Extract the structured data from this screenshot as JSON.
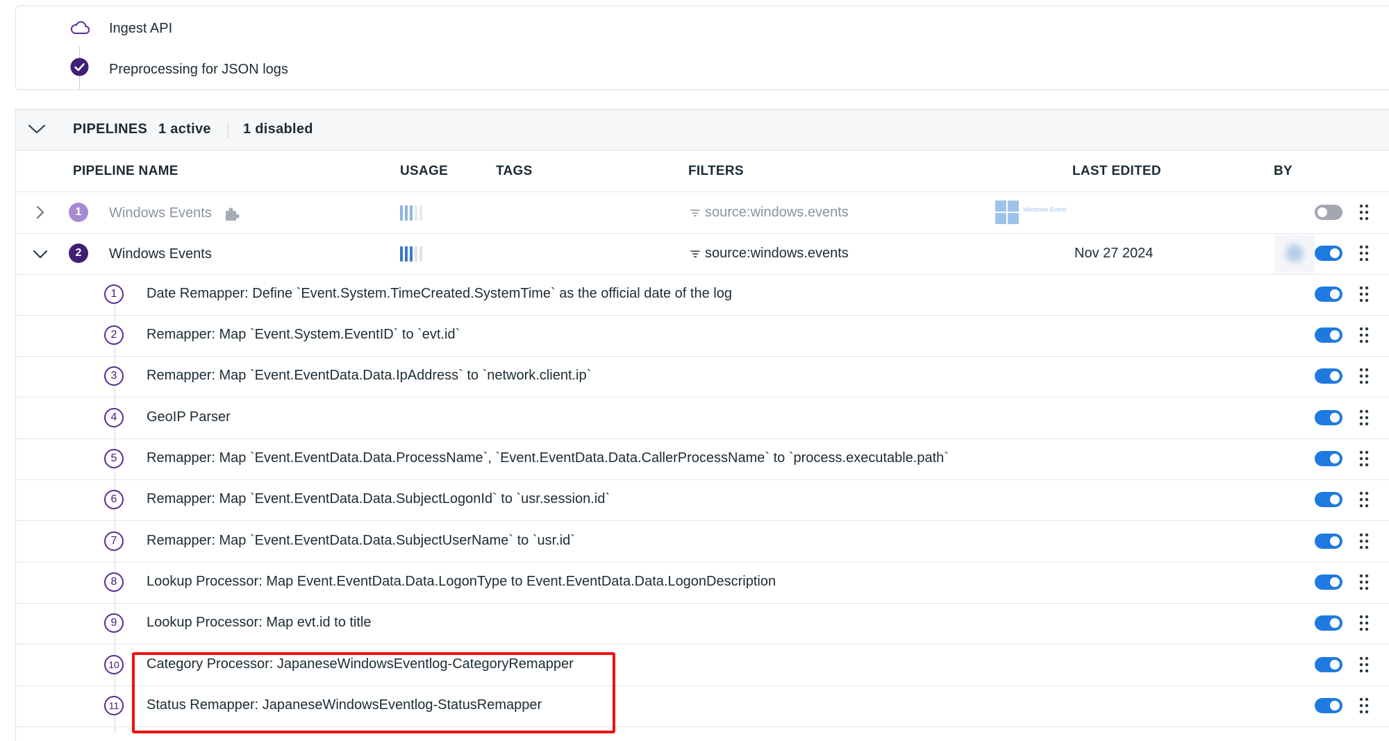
{
  "preprocessing": {
    "items": [
      {
        "label": "Ingest API",
        "icon": "cloud-icon"
      },
      {
        "label": "Preprocessing for JSON logs",
        "icon": "check-circle-icon"
      }
    ]
  },
  "pipelines_header": {
    "title": "PIPELINES",
    "active": "1 active",
    "disabled": "1 disabled"
  },
  "columns": [
    "PIPELINE NAME",
    "USAGE",
    "TAGS",
    "FILTERS",
    "LAST EDITED",
    "BY"
  ],
  "pipelines": [
    {
      "number": "1",
      "name": "Windows Events",
      "filter": "source:windows.events",
      "logo_text": "Windows Event",
      "last_edited": "",
      "enabled": false,
      "expanded": false,
      "usage_level": 3
    },
    {
      "number": "2",
      "name": "Windows Events",
      "filter": "source:windows.events",
      "last_edited": "Nov 27 2024",
      "enabled": true,
      "expanded": true,
      "usage_level": 3
    }
  ],
  "processors": [
    {
      "number": "1",
      "label": "Date Remapper: Define `Event.System.TimeCreated.SystemTime` as the official date of the log",
      "enabled": true
    },
    {
      "number": "2",
      "label": "Remapper: Map `Event.System.EventID` to `evt.id`",
      "enabled": true
    },
    {
      "number": "3",
      "label": "Remapper: Map `Event.EventData.Data.IpAddress` to `network.client.ip`",
      "enabled": true
    },
    {
      "number": "4",
      "label": "GeoIP Parser",
      "enabled": true
    },
    {
      "number": "5",
      "label": "Remapper: Map `Event.EventData.Data.ProcessName`, `Event.EventData.Data.CallerProcessName` to `process.executable.path`",
      "enabled": true
    },
    {
      "number": "6",
      "label": "Remapper: Map `Event.EventData.Data.SubjectLogonId` to `usr.session.id`",
      "enabled": true
    },
    {
      "number": "7",
      "label": "Remapper: Map `Event.EventData.Data.SubjectUserName` to `usr.id`",
      "enabled": true
    },
    {
      "number": "8",
      "label": "Lookup Processor: Map Event.EventData.Data.LogonType to Event.EventData.Data.LogonDescription",
      "enabled": true
    },
    {
      "number": "9",
      "label": "Lookup Processor: Map evt.id to title",
      "enabled": true
    },
    {
      "number": "10",
      "label": "Category Processor: JapaneseWindowsEventlog-CategoryRemapper",
      "enabled": true
    },
    {
      "number": "11",
      "label": "Status Remapper: JapaneseWindowsEventlog-StatusRemapper",
      "enabled": true
    }
  ],
  "colors": {
    "accent_purple": "#3f1f74",
    "toggle_on": "#1f7ae0",
    "toggle_off": "#a3a7b3",
    "highlight": "#ee1111"
  }
}
